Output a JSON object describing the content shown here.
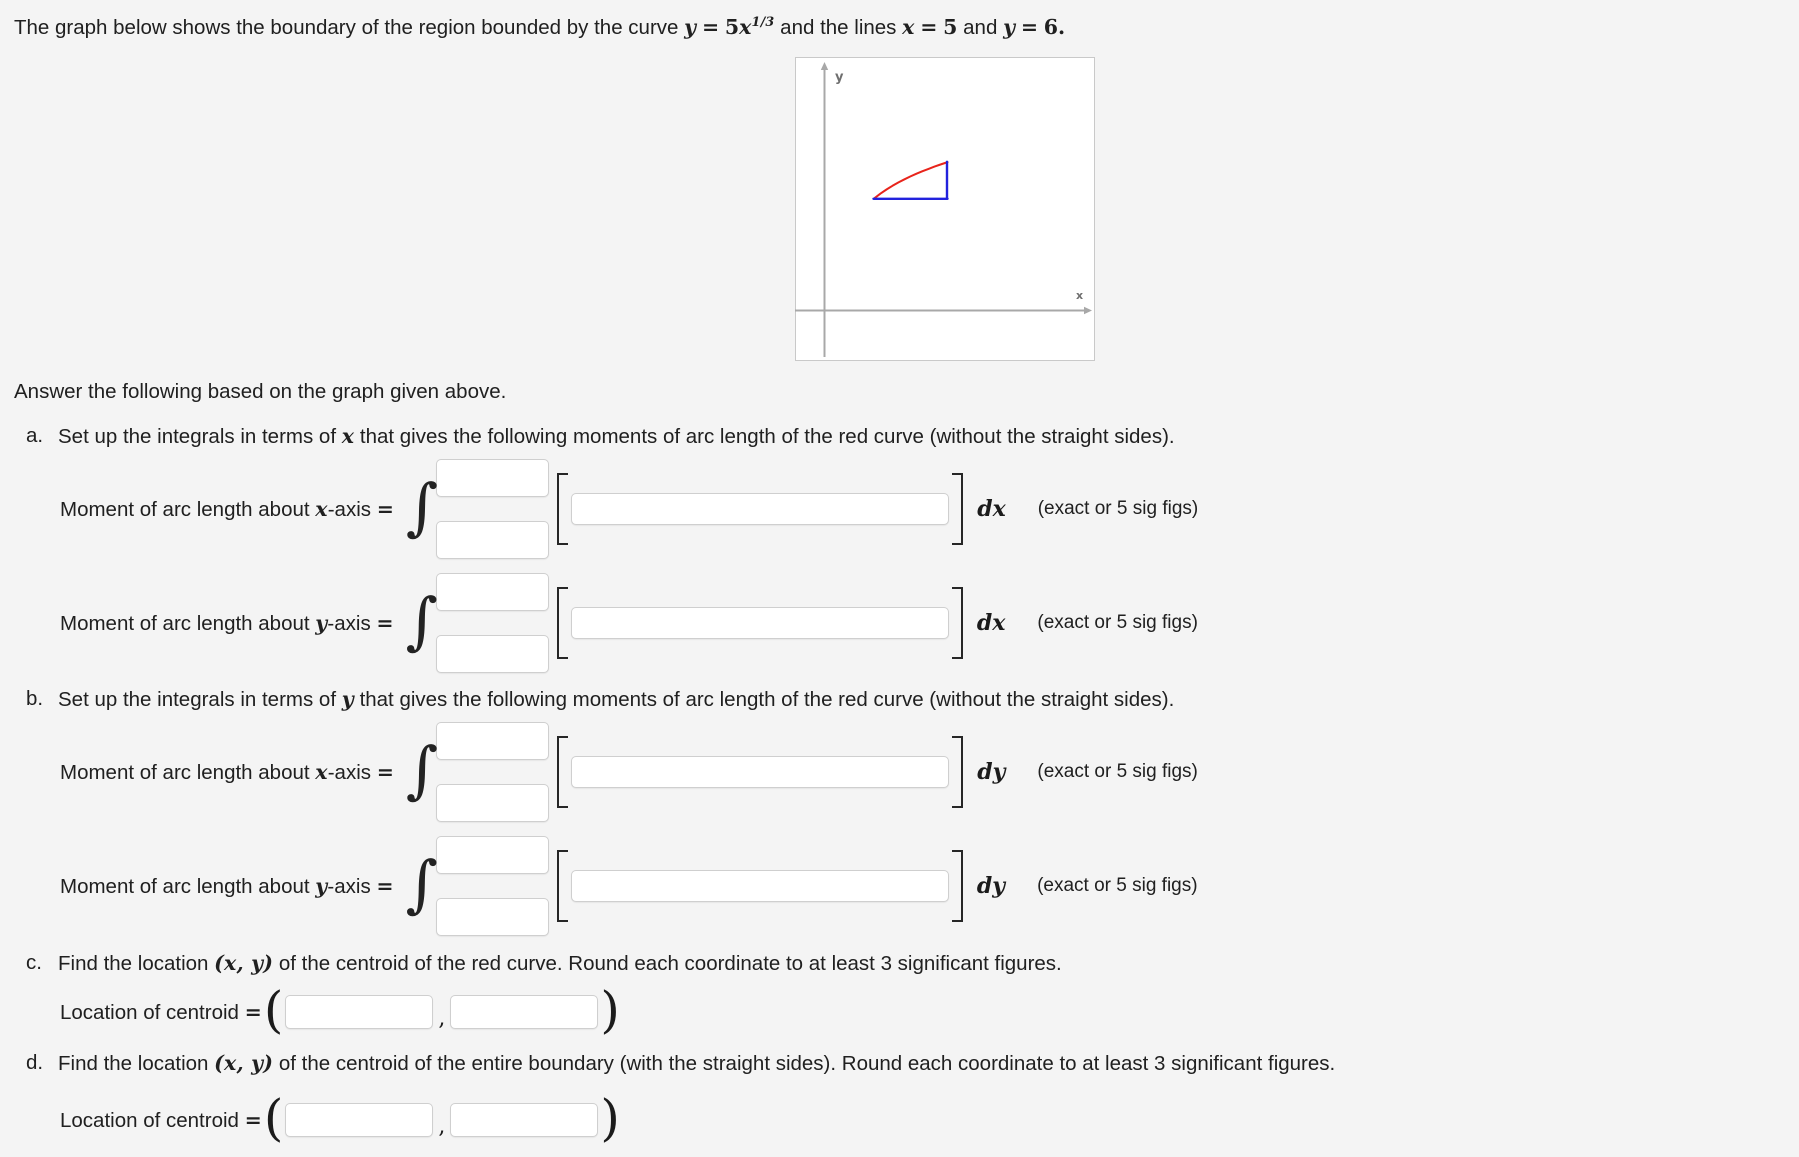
{
  "intro": {
    "part1": "The graph below shows the boundary of the region bounded by the curve",
    "curve_y": "y",
    "curve_eq": "=",
    "curve_coef": "5",
    "curve_var": "x",
    "curve_exp": "1/3",
    "part2": "and the lines",
    "line1_var": "x",
    "line1_eq": "=",
    "line1_val": "5",
    "conj": "and",
    "line2_var": "y",
    "line2_eq": "=",
    "line2_val": "6",
    "period": "."
  },
  "graph": {
    "x_axis_label": "x",
    "y_axis_label": "y",
    "curve_color": "#e8241b",
    "straight_color": "#2222dd",
    "axis_color": "#a8a8a8",
    "frame_color": "#c9c9c9",
    "background": "#ffffff"
  },
  "answer_intro": "Answer the following based on the graph given above.",
  "items": [
    {
      "letter": "a.",
      "text_before_var": "Set up the integrals in terms of",
      "var": "x",
      "text_after_var": "that gives the following moments of arc length of the red curve (without the straight sides)."
    },
    {
      "letter": "b.",
      "text_before_var": "Set up the integrals in terms of",
      "var": "y",
      "text_after_var": "that gives the following moments of arc length of the red curve (without the straight sides)."
    },
    {
      "letter": "c.",
      "text_before_var": "Find the location",
      "coords": "(x, y)",
      "text_after_var": "of the centroid of the red curve. Round each coordinate to at least 3 significant figures."
    },
    {
      "letter": "d.",
      "text_before_var": "Find the location",
      "coords": "(x, y)",
      "text_after_var": "of the centroid of the entire boundary (with the straight sides). Round each coordinate to at least 3 significant figures."
    }
  ],
  "moments": [
    {
      "label_prefix": "Moment of arc length about",
      "axis": "x",
      "label_suffix": "-axis",
      "equals": "=",
      "upper_limit": "",
      "lower_limit": "",
      "integrand": "",
      "differential": "dx",
      "hint": "(exact or 5 sig figs)",
      "placeholder": ""
    },
    {
      "label_prefix": "Moment of arc length about",
      "axis": "y",
      "label_suffix": "-axis",
      "equals": "=",
      "upper_limit": "",
      "lower_limit": "",
      "integrand": "",
      "differential": "dx",
      "hint": "(exact or 5 sig figs)",
      "placeholder": ""
    },
    {
      "label_prefix": "Moment of arc length about",
      "axis": "x",
      "label_suffix": "-axis",
      "equals": "=",
      "upper_limit": "",
      "lower_limit": "",
      "integrand": "",
      "differential": "dy",
      "hint": "(exact or 5 sig figs)",
      "placeholder": ""
    },
    {
      "label_prefix": "Moment of arc length about",
      "axis": "y",
      "label_suffix": "-axis",
      "equals": "=",
      "upper_limit": "",
      "lower_limit": "",
      "integrand": "",
      "differential": "dy",
      "hint": "(exact or 5 sig figs)",
      "placeholder": ""
    }
  ],
  "centroids": [
    {
      "label": "Location of centroid",
      "equals": "=",
      "x_value": "",
      "y_value": "",
      "separator": ",",
      "placeholder": ""
    },
    {
      "label": "Location of centroid",
      "equals": "=",
      "x_value": "",
      "y_value": "",
      "separator": ",",
      "placeholder": ""
    }
  ],
  "chart_data": {
    "type": "line",
    "title": "",
    "xlabel": "x",
    "ylabel": "y",
    "xlim": [
      -0.6,
      10.4
    ],
    "ylim": [
      -2.2,
      14.5
    ],
    "grid": false,
    "legend": "none",
    "series": [
      {
        "name": "y = 5x^(1/3)",
        "color": "#e8241b",
        "type": "curve",
        "x": [
          1.728,
          2.0,
          2.4,
          2.8,
          3.2,
          3.6,
          4.0,
          4.4,
          4.8,
          5.0
        ],
        "y": [
          6.0,
          6.3,
          6.69,
          7.05,
          7.37,
          7.67,
          7.94,
          8.2,
          8.43,
          8.55
        ]
      },
      {
        "name": "y = 6 (horizontal straight side)",
        "color": "#2222dd",
        "type": "segment",
        "x": [
          1.728,
          5.0
        ],
        "y": [
          6.0,
          6.0
        ]
      },
      {
        "name": "x = 5 (vertical straight side)",
        "color": "#2222dd",
        "type": "segment",
        "x": [
          5.0,
          5.0
        ],
        "y": [
          6.0,
          8.55
        ]
      }
    ]
  }
}
